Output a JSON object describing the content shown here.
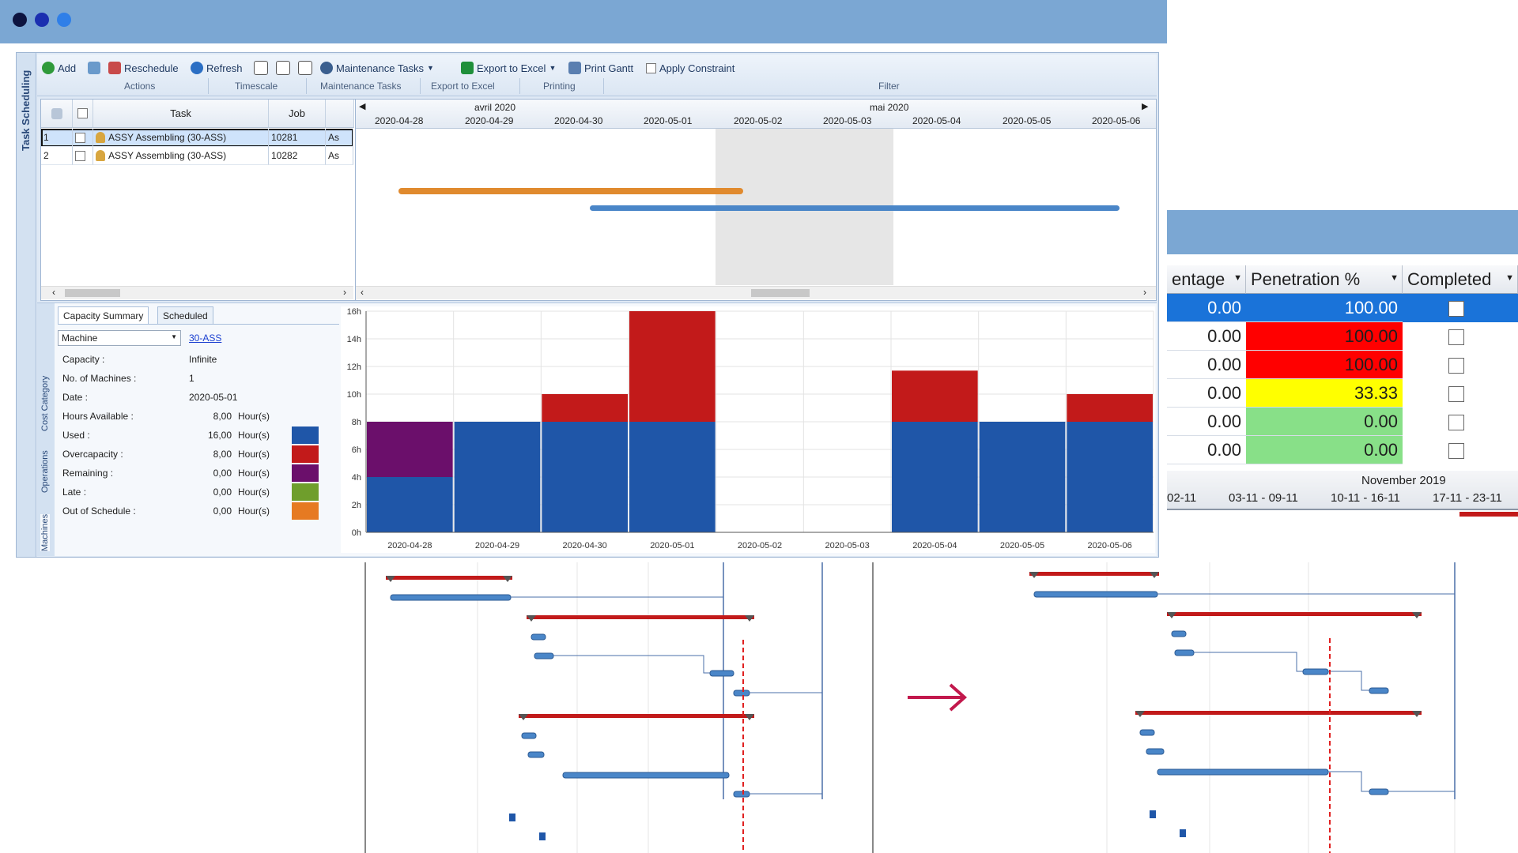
{
  "window": {
    "dots": [
      "#0d1440",
      "#1b2fb0",
      "#2f7fe8"
    ],
    "side_title": "Task Scheduling"
  },
  "ribbon": {
    "add": "Add",
    "reschedule": "Reschedule",
    "refresh": "Refresh",
    "maintenance_tasks": "Maintenance Tasks",
    "export_excel": "Export to Excel",
    "print_gantt": "Print Gantt",
    "apply_constraint": "Apply Constraint",
    "groups": {
      "actions": "Actions",
      "timescale": "Timescale",
      "maintenance_tasks": "Maintenance Tasks",
      "export_excel": "Export to Excel",
      "printing": "Printing",
      "filter": "Filter"
    }
  },
  "grid": {
    "columns": [
      "Task",
      "Job"
    ],
    "rows": [
      {
        "num": "1",
        "task": "ASSY Assembling (30-ASS)",
        "job": "10281",
        "extra": "As"
      },
      {
        "num": "2",
        "task": "ASSY Assembling (30-ASS)",
        "job": "10282",
        "extra": "As"
      }
    ]
  },
  "gantt": {
    "months": [
      "avril 2020",
      "mai 2020"
    ],
    "dates": [
      "2020-04-28",
      "2020-04-29",
      "2020-04-30",
      "2020-05-01",
      "2020-05-02",
      "2020-05-03",
      "2020-05-04",
      "2020-05-05",
      "2020-05-06"
    ],
    "bar_orange": "#e08a2e",
    "bar_blue": "#4a86c8"
  },
  "capacity": {
    "tabs": [
      "Capacity Summary",
      "Scheduled"
    ],
    "side_tabs": [
      "Cost Category",
      "Operations",
      "Machines"
    ],
    "resource_type": "Machine",
    "resource_link": "30-ASS",
    "capacity_label": "Capacity :",
    "capacity_value": "Infinite",
    "machines_label": "No. of Machines :",
    "machines_value": "1",
    "date_label": "Date :",
    "date_value": "2020-05-01",
    "metrics": [
      {
        "label": "Hours Available :",
        "value": "8,00",
        "unit": "Hour(s)",
        "color": ""
      },
      {
        "label": "Used :",
        "value": "16,00",
        "unit": "Hour(s)",
        "color": "#1f56a8"
      },
      {
        "label": "Overcapacity :",
        "value": "8,00",
        "unit": "Hour(s)",
        "color": "#c21a1a"
      },
      {
        "label": "Remaining :",
        "value": "0,00",
        "unit": "Hour(s)",
        "color": "#6b0f6b"
      },
      {
        "label": "Late :",
        "value": "0,00",
        "unit": "Hour(s)",
        "color": "#6f9e2c"
      },
      {
        "label": "Out of Schedule :",
        "value": "0,00",
        "unit": "Hour(s)",
        "color": "#e67a22"
      }
    ]
  },
  "chart_data": {
    "type": "bar",
    "categories": [
      "2020-04-28",
      "2020-04-29",
      "2020-04-30",
      "2020-05-01",
      "2020-05-02",
      "2020-05-03",
      "2020-05-04",
      "2020-05-05",
      "2020-05-06"
    ],
    "series": [
      {
        "values": [
          4,
          8,
          8,
          8,
          0,
          0,
          8,
          8,
          8
        ],
        "color": "#1f56a8"
      },
      {
        "values": [
          4,
          0,
          0,
          0,
          0,
          0,
          0,
          0,
          0
        ],
        "color": "#6b0f6b"
      },
      {
        "values": [
          0,
          0,
          2,
          8,
          0,
          0,
          3.7,
          0,
          2
        ],
        "color": "#c21a1a"
      }
    ],
    "yticks": [
      "0h",
      "2h",
      "4h",
      "6h",
      "8h",
      "10h",
      "12h",
      "14h",
      "16h"
    ],
    "ylim": [
      0,
      16
    ],
    "stacked": true,
    "grid": true
  },
  "right_panel": {
    "headers": [
      "entage",
      "Penetration %",
      "Completed"
    ],
    "rows": [
      {
        "a": "0.00",
        "b": "100.00",
        "b_color": "#1a73d9",
        "selected": true
      },
      {
        "a": "0.00",
        "b": "100.00",
        "b_color": "#ff0000",
        "selected": false
      },
      {
        "a": "0.00",
        "b": "100.00",
        "b_color": "#ff0000",
        "selected": false
      },
      {
        "a": "0.00",
        "b": "33.33",
        "b_color": "#ffff00",
        "selected": false
      },
      {
        "a": "0.00",
        "b": "0.00",
        "b_color": "#88e088",
        "selected": false
      },
      {
        "a": "0.00",
        "b": "0.00",
        "b_color": "#88e088",
        "selected": false
      }
    ],
    "month": "November 2019",
    "weeks": [
      "02-11",
      "03-11 - 09-11",
      "10-11 - 16-11",
      "17-11 - 23-11"
    ]
  }
}
